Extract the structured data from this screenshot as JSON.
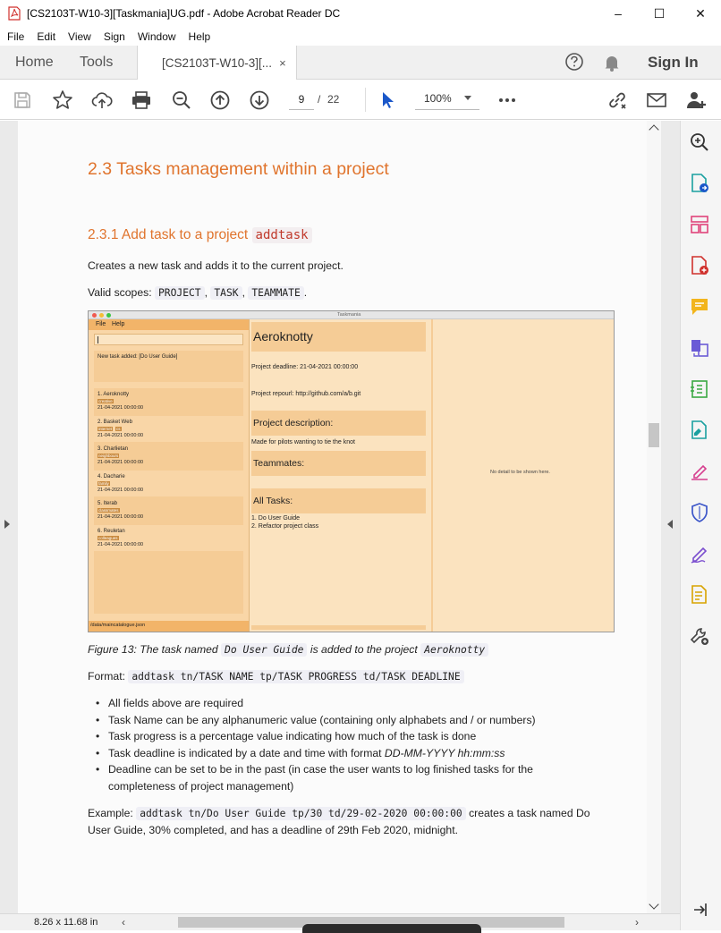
{
  "window": {
    "title": "[CS2103T-W10-3][Taskmania]UG.pdf - Adobe Acrobat Reader DC",
    "minimize": "–",
    "maximize": "☐",
    "close": "✕"
  },
  "menu": [
    "File",
    "Edit",
    "View",
    "Sign",
    "Window",
    "Help"
  ],
  "tabs": {
    "home": "Home",
    "tools": "Tools",
    "document": "[CS2103T-W10-3][...",
    "close": "×",
    "sign_in": "Sign In"
  },
  "toolbar": {
    "page_current": "9",
    "page_sep": "/",
    "page_total": "22",
    "zoom": "100%"
  },
  "document": {
    "h2": "2.3 Tasks management within a project",
    "h3_text": "2.3.1 Add task to a project",
    "h3_code": "addtask",
    "intro": "Creates a new task and adds it to the current project.",
    "scopes_label": "Valid scopes:",
    "scopes": [
      "PROJECT",
      "TASK",
      "TEAMMATE"
    ],
    "figure_caption": {
      "pre": "Figure 13: The task named",
      "code1": "Do User Guide",
      "mid": "is added to the project",
      "code2": "Aeroknotty"
    },
    "format_label": "Format:",
    "format_code": "addtask tn/TASK NAME tp/TASK PROGRESS td/TASK DEADLINE",
    "bullets": [
      "All fields above are required",
      "Task Name can be any alphanumeric value (containing only alphabets and / or numbers)",
      "Task progress is a percentage value indicating how much of the task is done",
      "Task deadline is indicated by a date and time with format",
      "Deadline can be set to be in the past (in case the user wants to log finished tasks for the",
      "completeness of project management)"
    ],
    "deadline_format": "DD-MM-YYYY hh:mm:ss",
    "example_label": "Example:",
    "example_code": "addtask tn/Do User Guide tp/30 td/29-02-2020 00:00:00",
    "example_rest1": "creates a task named Do",
    "example_rest2": "User Guide, 30% completed, and has a deadline of 29th Feb 2020, midnight."
  },
  "screenshot": {
    "window_title": "Taskmania",
    "menu": [
      "File",
      "Help"
    ],
    "result": "New task added: [Do User Guide]",
    "projects": [
      {
        "name": "1.  Aeroknotty",
        "tags": [
          "creative"
        ],
        "date": "21-04-2021 00:00:00"
      },
      {
        "name": "2.  Basket Web",
        "tags": [
          "internet",
          "cs"
        ],
        "date": "21-04-2021 00:00:00"
      },
      {
        "name": "3.  Charlietan",
        "tags": [
          "neighbours"
        ],
        "date": "21-04-2021 00:00:00"
      },
      {
        "name": "4.  Dacharie",
        "tags": [
          "family"
        ],
        "date": "21-04-2021 00:00:00"
      },
      {
        "name": "5.  Iterab",
        "tags": [
          "classmates"
        ],
        "date": "21-04-2021 00:00:00"
      },
      {
        "name": "6.  Reuletan",
        "tags": [
          "colleagues"
        ],
        "date": "21-04-2021 00:00:00"
      }
    ],
    "status": "/data/maincatalogue.json",
    "project_title": "Aeroknotty",
    "deadline": "Project deadline: 21-04-2021 00:00:00",
    "repo": "Project repourl: http://github.com/a/b.git",
    "desc_header": "Project description:",
    "desc": "Made for pilots wanting to tie the knot",
    "teammates_header": "Teammates:",
    "tasks_header": "All Tasks:",
    "tasks": [
      "1. Do User Guide",
      "2. Refactor project class"
    ],
    "detail_empty": "No detail to be shown here."
  },
  "statusbar": {
    "page_size": "8.26 x 11.68 in"
  },
  "colors": {
    "heading": "#e0742d",
    "app_bg": "#f5d9ab",
    "acrobat_red": "#d0312d"
  }
}
